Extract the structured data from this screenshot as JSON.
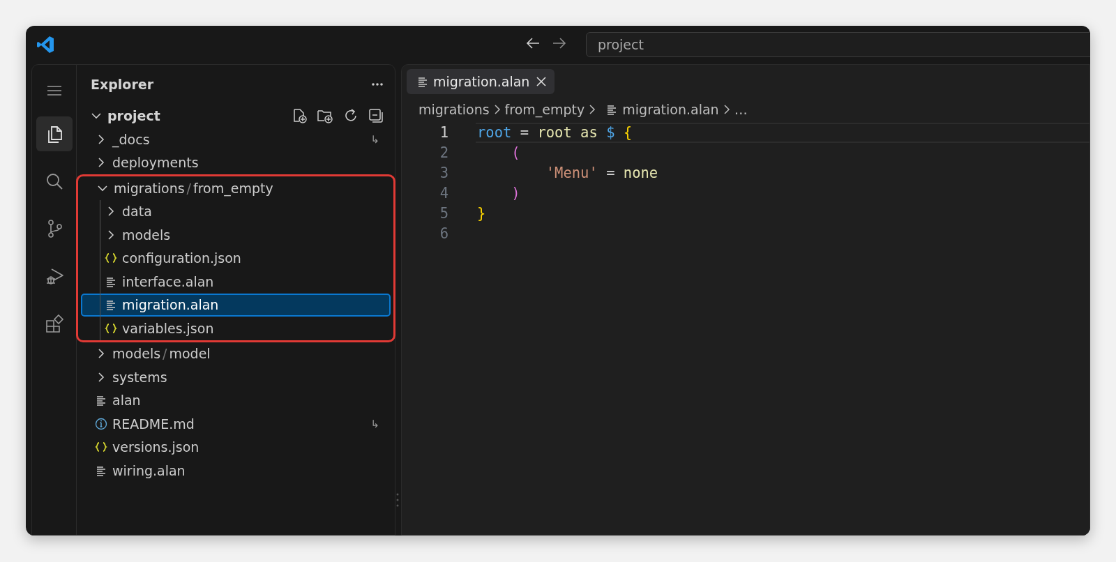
{
  "title_bar": {
    "command_center": "project"
  },
  "activity_bar": [
    {
      "kind": "menu",
      "selected": false
    },
    {
      "kind": "files",
      "selected": true
    },
    {
      "kind": "search",
      "selected": false
    },
    {
      "kind": "branch",
      "selected": false
    },
    {
      "kind": "debug",
      "selected": false
    },
    {
      "kind": "extensions",
      "selected": false
    }
  ],
  "explorer": {
    "title": "Explorer",
    "root": {
      "label": "project",
      "expanded": true,
      "children": [
        {
          "kind": "folder",
          "segments": [
            "_docs"
          ],
          "expanded": false,
          "selected": false,
          "badge": "↳"
        },
        {
          "kind": "folder",
          "segments": [
            "deployments"
          ],
          "expanded": false,
          "selected": false
        },
        {
          "kind": "folder",
          "segments": [
            "migrations",
            "from_empty"
          ],
          "separator": "/",
          "expanded": true,
          "selected": false,
          "annotated": true,
          "children": [
            {
              "kind": "folder",
              "segments": [
                "data"
              ],
              "expanded": false,
              "selected": false
            },
            {
              "kind": "folder",
              "segments": [
                "models"
              ],
              "expanded": false,
              "selected": false
            },
            {
              "kind": "json",
              "segments": [
                "configuration.json"
              ],
              "selected": false
            },
            {
              "kind": "text",
              "segments": [
                "interface.alan"
              ],
              "selected": false
            },
            {
              "kind": "text",
              "segments": [
                "migration.alan"
              ],
              "selected": true
            },
            {
              "kind": "json",
              "segments": [
                "variables.json"
              ],
              "selected": false
            }
          ]
        },
        {
          "kind": "folder",
          "segments": [
            "models",
            "model"
          ],
          "separator": "/",
          "expanded": false,
          "selected": false
        },
        {
          "kind": "folder",
          "segments": [
            "systems"
          ],
          "expanded": false,
          "selected": false
        },
        {
          "kind": "text",
          "segments": [
            "alan"
          ],
          "selected": false
        },
        {
          "kind": "info",
          "segments": [
            "README.md"
          ],
          "selected": false,
          "badge": "↳"
        },
        {
          "kind": "json",
          "segments": [
            "versions.json"
          ],
          "selected": false
        },
        {
          "kind": "text",
          "segments": [
            "wiring.alan"
          ],
          "selected": false
        }
      ]
    }
  },
  "editor": {
    "tabs": [
      {
        "label": "migration.alan",
        "selected": true
      }
    ],
    "breadcrumbs": [
      {
        "label": "migrations",
        "kind": "folder"
      },
      {
        "label": "from_empty",
        "kind": "folder"
      },
      {
        "label": "migration.alan",
        "kind": "file"
      },
      {
        "label": "…",
        "kind": "more"
      }
    ],
    "lines": [
      {
        "number": "1",
        "current": true,
        "tokens": [
          {
            "text": "root",
            "kind": "variable"
          },
          {
            "text": " = ",
            "kind": "operator"
          },
          {
            "text": "root",
            "kind": "name"
          },
          {
            "text": " as ",
            "kind": "name"
          },
          {
            "text": "$",
            "kind": "variable"
          },
          {
            "text": " {",
            "kind": "brace"
          }
        ]
      },
      {
        "number": "2",
        "current": false,
        "tokens": [
          {
            "text": "    (",
            "kind": "paren"
          }
        ]
      },
      {
        "number": "3",
        "current": false,
        "tokens": [
          {
            "text": "        'Menu'",
            "kind": "string"
          },
          {
            "text": " = ",
            "kind": "operator"
          },
          {
            "text": "none",
            "kind": "name"
          }
        ]
      },
      {
        "number": "4",
        "current": false,
        "tokens": [
          {
            "text": "    )",
            "kind": "paren"
          }
        ]
      },
      {
        "number": "5",
        "current": false,
        "tokens": [
          {
            "text": "}",
            "kind": "brace"
          }
        ]
      },
      {
        "number": "6",
        "current": false
      }
    ]
  }
}
